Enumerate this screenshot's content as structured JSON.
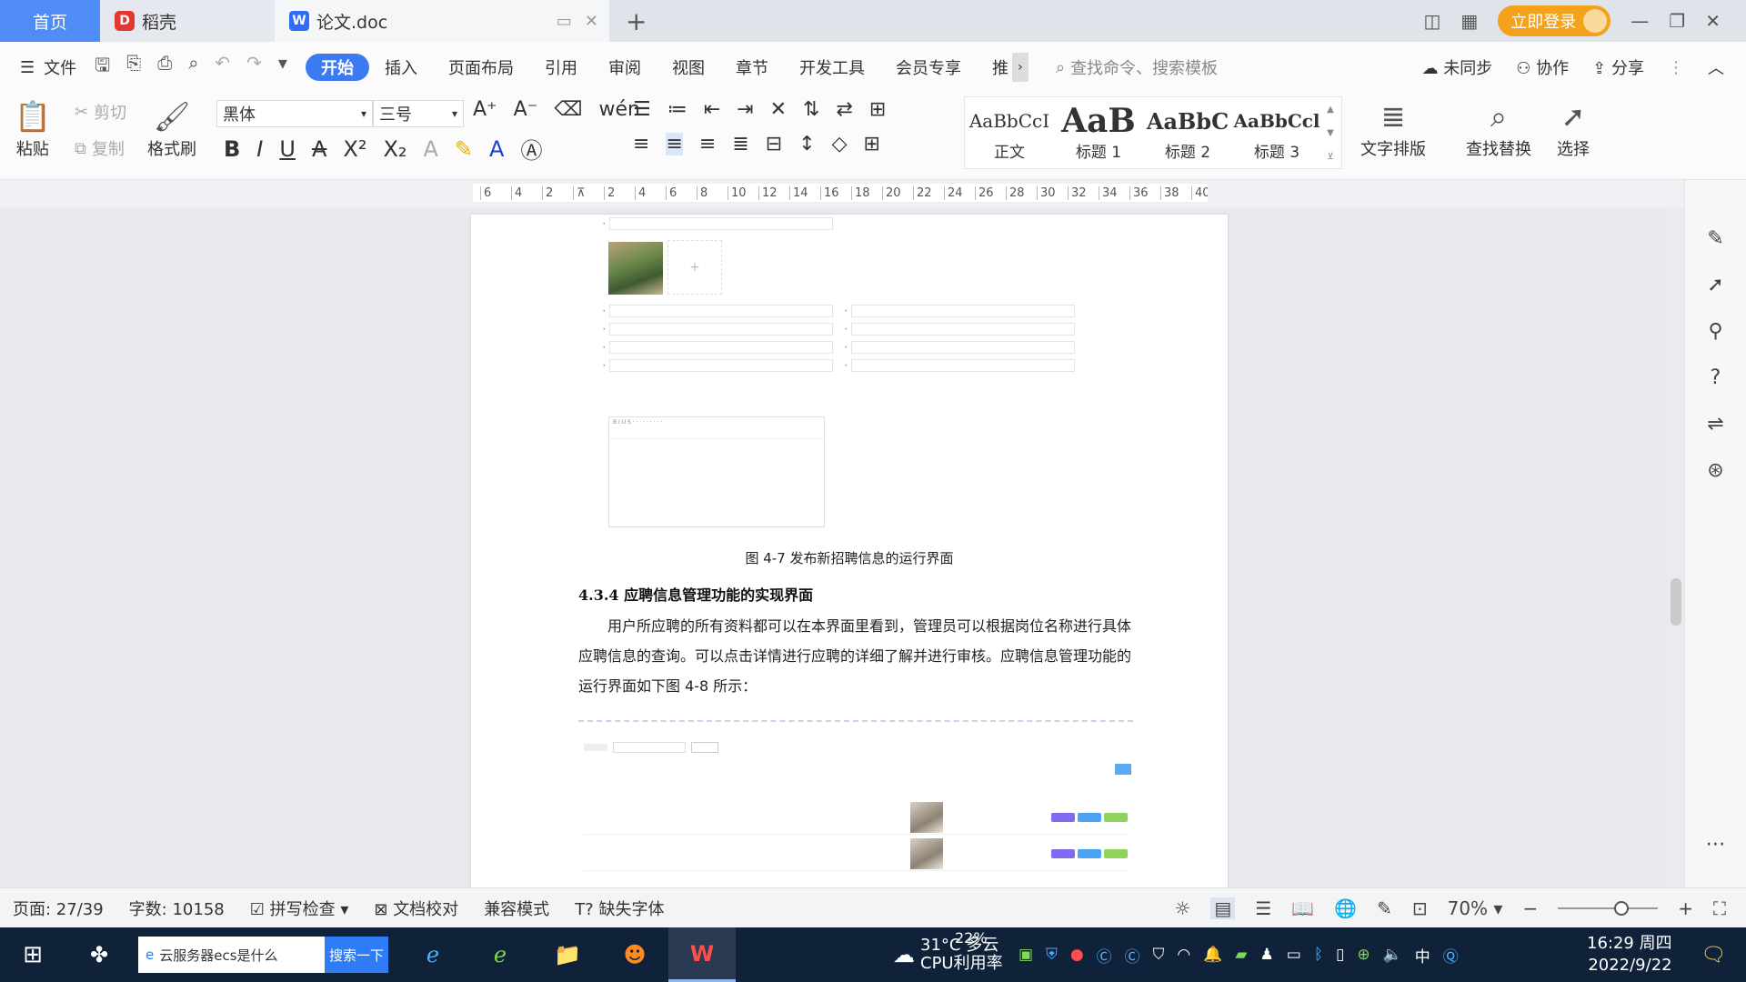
{
  "tabs": {
    "home": "首页",
    "daoke": "稻壳",
    "doc": "论文.doc",
    "login": "立即登录"
  },
  "menu": {
    "file": "文件",
    "items": [
      "开始",
      "插入",
      "页面布局",
      "引用",
      "审阅",
      "视图",
      "章节",
      "开发工具",
      "会员专享",
      "推"
    ],
    "active_index": 0,
    "search_placeholder": "查找命令、搜索模板",
    "right": [
      "未同步",
      "协作",
      "分享"
    ]
  },
  "ribbon": {
    "paste": "粘贴",
    "cut": "剪切",
    "copy": "复制",
    "format_painter": "格式刷",
    "font_name": "黑体",
    "font_size": "三号",
    "styles": [
      {
        "sample": "AaBbCcI",
        "label": "正文"
      },
      {
        "sample": "AaB",
        "label": "标题 1"
      },
      {
        "sample": "AaBbC",
        "label": "标题 2"
      },
      {
        "sample": "AaBbCcl",
        "label": "标题 3"
      }
    ],
    "text_layout": "文字排版",
    "find_replace": "查找替换",
    "select": "选择"
  },
  "ruler": {
    "ticks": [
      "6",
      "4",
      "2",
      "",
      "2",
      "4",
      "6",
      "8",
      "10",
      "12",
      "14",
      "16",
      "18",
      "20",
      "22",
      "24",
      "26",
      "28",
      "30",
      "32",
      "34",
      "36",
      "38",
      "40"
    ]
  },
  "document": {
    "caption": "图 4-7 发布新招聘信息的运行界面",
    "heading": "4.3.4  应聘信息管理功能的实现界面",
    "paragraph": "用户所应聘的所有资料都可以在本界面里看到，管理员可以根据岗位名称进行具体应聘信息的查询。可以点击详情进行应聘的详细了解并进行审核。应聘信息管理功能的运行界面如下图 4-8 所示："
  },
  "status": {
    "page": "页面: 27/39",
    "words": "字数: 10158",
    "spell": "拼写检查",
    "proof": "文档校对",
    "compat": "兼容模式",
    "missing_font": "缺失字体",
    "zoom": "70%"
  },
  "taskbar": {
    "search_text": "云服务器ecs是什么",
    "search_button": "搜索一下",
    "weather_temp": "31°C 多云",
    "cpu": "22%",
    "cpu_label": "CPU利用率",
    "ime": "中",
    "time": "16:29 周四",
    "date": "2022/9/22"
  }
}
